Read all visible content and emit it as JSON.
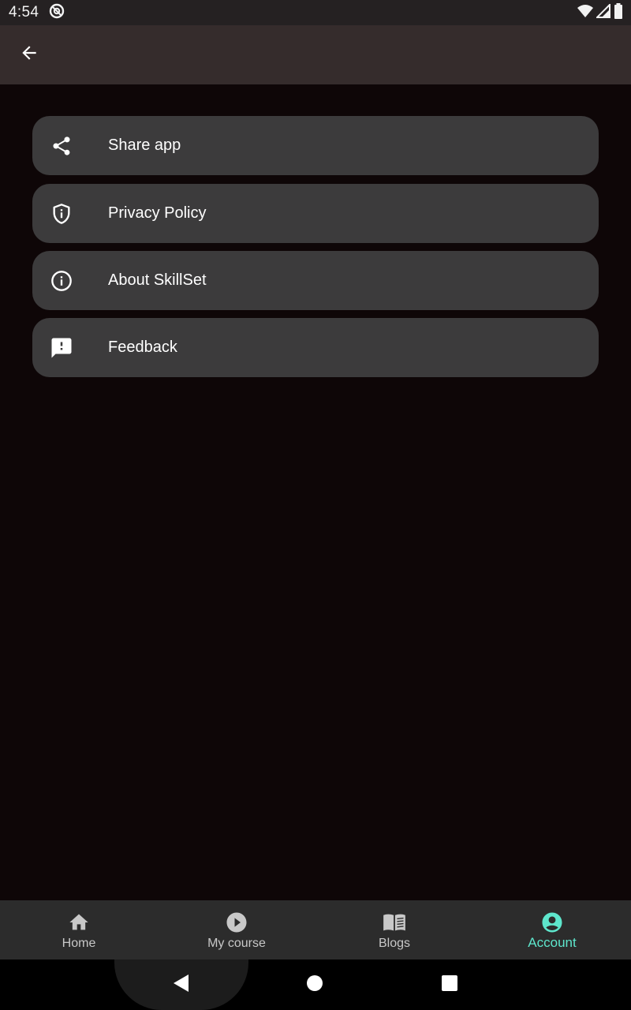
{
  "status_bar": {
    "time": "4:54",
    "left_icons": [
      "no-disturb-icon"
    ],
    "right_icons": [
      "wifi-icon",
      "signal-icon",
      "battery-icon"
    ]
  },
  "app_bar": {
    "back_icon": "arrow-back-icon"
  },
  "menu": {
    "items": [
      {
        "label": "Share app",
        "icon": "share-icon"
      },
      {
        "label": "Privacy Policy",
        "icon": "shield-info-icon"
      },
      {
        "label": "About SkillSet",
        "icon": "info-icon"
      },
      {
        "label": "Feedback",
        "icon": "feedback-icon"
      }
    ]
  },
  "bottom_nav": {
    "items": [
      {
        "label": "Home",
        "icon": "home-icon",
        "active": false
      },
      {
        "label": "My course",
        "icon": "play-circle-icon",
        "active": false
      },
      {
        "label": "Blogs",
        "icon": "book-icon",
        "active": false
      },
      {
        "label": "Account",
        "icon": "account-circle-icon",
        "active": true
      }
    ]
  },
  "colors": {
    "background": "#0e0607",
    "app_bar": "#352c2c",
    "menu_item": "#3c3b3c",
    "bottom_nav": "#2c2c2c",
    "accent": "#5ee6cc"
  }
}
